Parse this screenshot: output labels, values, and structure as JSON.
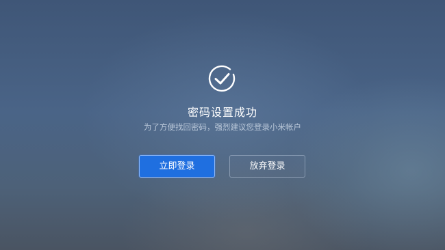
{
  "dialog": {
    "icon": "check-circle-icon",
    "title": "密码设置成功",
    "subtitle": "为了方便找回密码，强烈建议您登录小米帐户",
    "primary_button": "立即登录",
    "secondary_button": "放弃登录"
  },
  "colors": {
    "primary": "#1f6fe0",
    "text": "#ffffff"
  }
}
